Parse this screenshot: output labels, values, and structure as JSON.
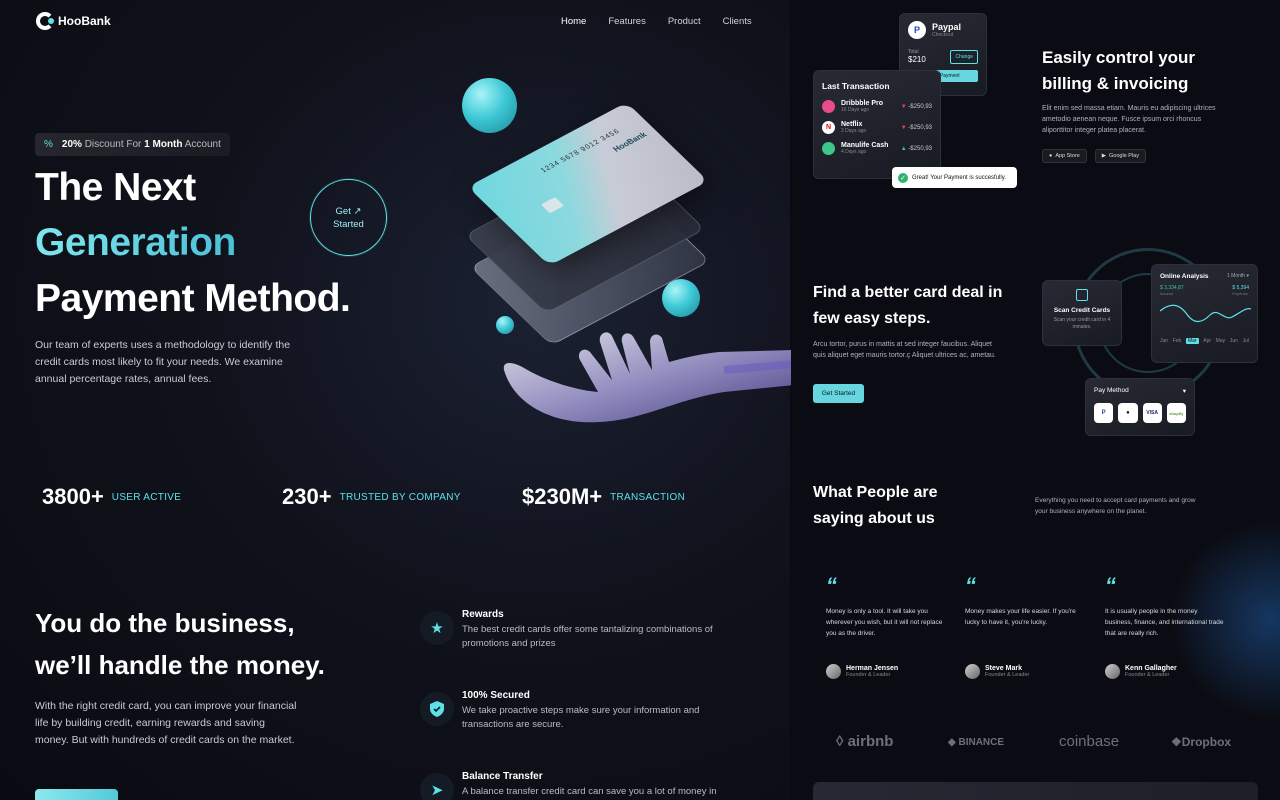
{
  "brand": {
    "name": "HooBank"
  },
  "nav": [
    {
      "label": "Home"
    },
    {
      "label": "Features"
    },
    {
      "label": "Product"
    },
    {
      "label": "Clients"
    }
  ],
  "hero": {
    "badge_strong_1": "20%",
    "badge_text_1": "Discount For",
    "badge_strong_2": "1 Month",
    "badge_text_2": "Account",
    "line1": "The Next",
    "line2": "Generation",
    "line3": "Payment Method.",
    "cta_line1": "Get",
    "cta_line2": "Started",
    "paragraph": "Our team of experts uses a methodology to identify the credit cards most likely to fit your needs. We examine annual percentage rates, annual fees.",
    "card_number": "1234 5678 9012 3456",
    "card_brand": "HooBank"
  },
  "stats": [
    {
      "value": "3800+",
      "label": "USER ACTIVE"
    },
    {
      "value": "230+",
      "label": "TRUSTED BY COMPANY"
    },
    {
      "value": "$230M+",
      "label": "TRANSACTION"
    }
  ],
  "business": {
    "line1": "You do the business,",
    "line2": "we’ll handle the money.",
    "paragraph": "With the right credit card, you can improve your financial life by building credit, earning rewards and saving money. But with hundreds of credit cards on the market."
  },
  "features": [
    {
      "title": "Rewards",
      "desc": "The best credit cards offer some tantalizing combinations of promotions and prizes"
    },
    {
      "title": "100% Secured",
      "desc": "We take proactive steps make sure your information and transactions are secure."
    },
    {
      "title": "Balance Transfer",
      "desc": "A balance transfer credit card can save you a lot of money in"
    }
  ],
  "paypal": {
    "title": "Paypal",
    "sub": "Checkout",
    "total_label": "Total",
    "total": "$210",
    "change": "Change",
    "button": "Make Payment"
  },
  "last_transaction": {
    "title": "Last Transaction",
    "items": [
      {
        "name": "Dribbble Pro",
        "sub": "16 Days ago",
        "amount": "-$250,93"
      },
      {
        "name": "Netflix",
        "sub": "2 Days ago",
        "amount": "-$250,93"
      },
      {
        "name": "Manulife Cash",
        "sub": "4 Days ago",
        "amount": "-$250,93"
      }
    ]
  },
  "toast": "Great! Your Payment is succesfully.",
  "billing": {
    "title": "Easily control your billing & invoicing",
    "paragraph": "Elit enim sed massa etiam. Mauris eu adipiscing ultrices ametodio aenean neque. Fusce ipsum orci rhoncus aliporttitor integer platea placerat.",
    "app_store": "App Store",
    "google_play": "Google Play"
  },
  "deal": {
    "title": "Find a better card deal in few easy steps.",
    "paragraph": "Arcu tortor, purus in mattis at sed integer faucibus. Aliquet quis aliquet eget mauris tortor.ç Aliquet ultrices ac, ametau.",
    "button": "Get Started"
  },
  "scan": {
    "title": "Scan Credit Cards",
    "sub": "Scan your credit card in 4 minutes."
  },
  "analysis": {
    "title": "Online Analysis",
    "period": "1 Month",
    "value1": "$ 3,334,87",
    "value1_label": "Income",
    "value2": "$ 5,394",
    "value2_label": "Expense",
    "months": [
      "Jan",
      "Feb",
      "Mar",
      "Apr",
      "May",
      "Jun",
      "Jul"
    ]
  },
  "pay_method": {
    "title": "Pay Method",
    "icons": [
      "P",
      "",
      "VISA",
      "shopify"
    ]
  },
  "testimonials": {
    "title": "What People are saying about us",
    "side_text": "Everything you need to accept card payments and grow your business anywhere on the planet.",
    "items": [
      {
        "text": "Money is only a tool. It will take you wherever you wish, but it will not replace you as the driver.",
        "name": "Herman Jensen",
        "role": "Founder & Leader"
      },
      {
        "text": "Money makes your life easier. If you're lucky to have it, you're lucky.",
        "name": "Steve Mark",
        "role": "Founder & Leader"
      },
      {
        "text": "It is usually people in the money business, finance, and international trade that are really rich.",
        "name": "Kenn Gallagher",
        "role": "Founder & Leader"
      }
    ]
  },
  "partners": [
    "airbnb",
    "BINANCE",
    "coinbase",
    "Dropbox"
  ],
  "colors": {
    "accent": "#5ce1e6",
    "background": "#0a0b12"
  }
}
